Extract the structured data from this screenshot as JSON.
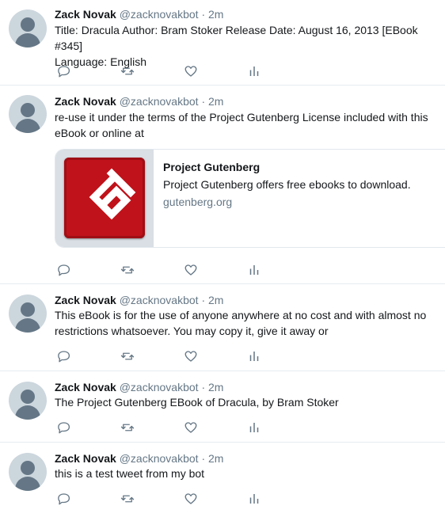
{
  "colors": {
    "name": "#14171a",
    "secondary": "#657786",
    "divider": "#e6ecf0",
    "icon": "#657786",
    "gutenberg_red": "#c0121a"
  },
  "tweets": [
    {
      "name": "Zack Novak",
      "handle": "@zacknovakbot",
      "separator": "·",
      "time": "2m",
      "lines": [
        "Title: Dracula Author: Bram Stoker Release Date: August 16, 2013 [EBook #345]",
        "Language: English"
      ]
    },
    {
      "name": "Zack Novak",
      "handle": "@zacknovakbot",
      "separator": "·",
      "time": "2m",
      "lines": [
        "re-use it under the terms of the Project Gutenberg License included with this",
        "eBook or online at"
      ],
      "card": {
        "title": "Project Gutenberg",
        "description": "Project Gutenberg offers free ebooks to download.",
        "domain": "gutenberg.org"
      }
    },
    {
      "name": "Zack Novak",
      "handle": "@zacknovakbot",
      "separator": "·",
      "time": "2m",
      "lines": [
        "This eBook is for the use of anyone anywhere at no cost and with almost no",
        "restrictions whatsoever.  You may copy it, give it away or"
      ]
    },
    {
      "name": "Zack Novak",
      "handle": "@zacknovakbot",
      "separator": "·",
      "time": "2m",
      "lines": [
        "The Project Gutenberg EBook of Dracula, by Bram Stoker"
      ]
    },
    {
      "name": "Zack Novak",
      "handle": "@zacknovakbot",
      "separator": "·",
      "time": "2m",
      "lines": [
        "this is a test tweet from my bot"
      ]
    }
  ],
  "action_icons": [
    "reply-icon",
    "retweet-icon",
    "like-icon",
    "analytics-icon"
  ]
}
